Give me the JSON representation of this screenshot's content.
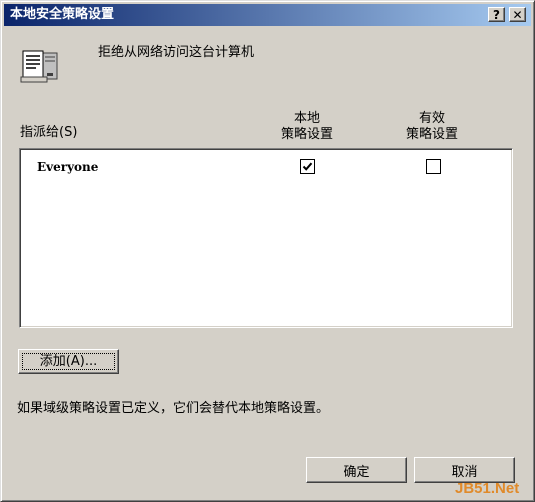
{
  "window": {
    "title": "本地安全策略设置",
    "help_label": "?",
    "close_label": "✕"
  },
  "policy": {
    "name": "拒绝从网络访问这台计算机",
    "icon": "policy-document-icon"
  },
  "columns": {
    "local": [
      "本地",
      "策略设置"
    ],
    "effective": [
      "有效",
      "策略设置"
    ]
  },
  "assign_label": "指派给(S)",
  "list": {
    "rows": [
      {
        "name": "Everyone",
        "local_checked": true,
        "effective_checked": false
      }
    ]
  },
  "buttons": {
    "add": "添加(A)...",
    "ok": "确定",
    "cancel": "取消"
  },
  "note": "如果域级策略设置已定义，它们会替代本地策略设置。",
  "watermark": "JB51.Net",
  "colors": {
    "face": "#d4d0c8",
    "title_start": "#0a246a",
    "title_end": "#a6caf0"
  }
}
